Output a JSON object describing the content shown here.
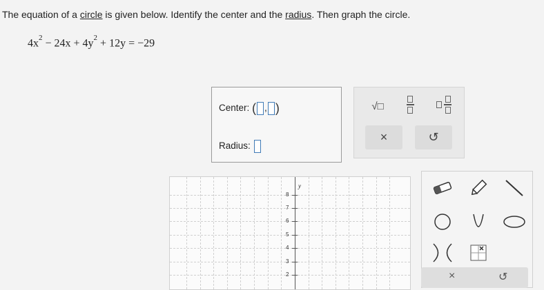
{
  "prompt": {
    "part1": "The equation of a ",
    "link1": "circle",
    "part2": " is given below. Identify the center and the ",
    "link2": "radius",
    "part3": ". Then graph the circle."
  },
  "equation": {
    "t1": "4x",
    "e1": "2",
    "t2": " − 24x + 4y",
    "e2": "2",
    "t3": " + 12y = −29"
  },
  "answer": {
    "center_label": "Center:",
    "radius_label": "Radius:",
    "open_paren": "(",
    "comma": ",",
    "close_paren": ")"
  },
  "toolbar": {
    "sqrt_label": "√□",
    "clear_label": "×",
    "undo_label": "↺"
  },
  "graph": {
    "axis_label": "y",
    "y_ticks": [
      "8",
      "7",
      "6",
      "5",
      "4",
      "3",
      "2"
    ]
  },
  "icons": {
    "eraser": "eraser-icon",
    "pencil": "pencil-icon",
    "line": "line-segment-icon",
    "circle": "circle-icon",
    "parabola": "parabola-icon",
    "ellipse": "ellipse-icon",
    "hyperbola": "hyperbola-icon",
    "point": "point-icon"
  },
  "colors": {
    "slot_border": "#3f7ab6",
    "background": "#f3f3f3"
  }
}
